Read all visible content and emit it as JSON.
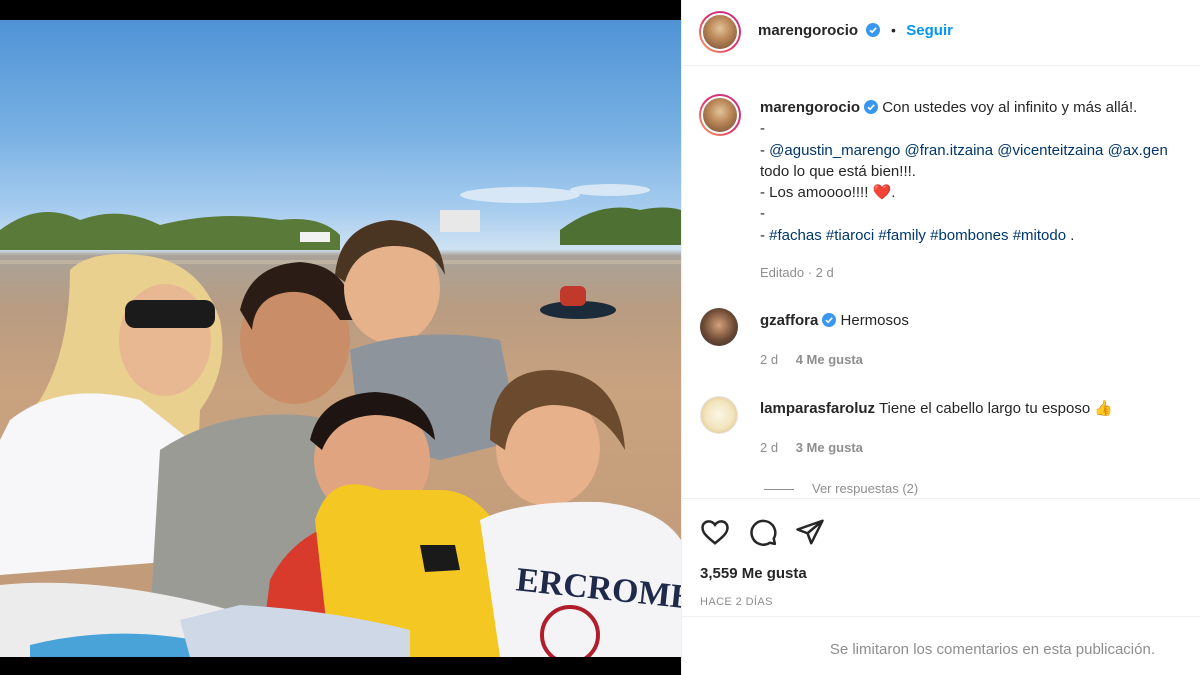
{
  "post": {
    "username": "marengorocio",
    "follow_label": "Seguir",
    "separator": "•"
  },
  "caption": {
    "username": "marengorocio",
    "line1": "Con ustedes voy al infinito y más allá!.",
    "line2": "-",
    "mentions": [
      "@agustin_marengo",
      "@fran.itzaina",
      "@vicenteitzaina",
      "@ax.gen"
    ],
    "line4": "todo lo que está bien!!!.",
    "line5": "- Los amoooo!!!! ",
    "line5_emoji": "❤️",
    "line5_end": ".",
    "line6": "-",
    "hashtags": [
      "#fachas",
      "#tiaroci",
      "#family",
      "#bombones",
      "#mitodo"
    ],
    "hashtags_end": ".",
    "edited": "Editado · 2 d"
  },
  "comments": [
    {
      "username": "gzaffora",
      "verified": true,
      "text": "Hermosos",
      "age": "2 d",
      "likes": "4 Me gusta"
    },
    {
      "username": "lamparasfaroluz",
      "verified": false,
      "text": "Tiene el cabello largo tu esposo",
      "emoji": "👍",
      "age": "2 d",
      "likes": "3 Me gusta",
      "replies": "Ver respuestas (2)"
    }
  ],
  "actions": {
    "likes": "3,559 Me gusta",
    "date": "HACE 2 DÍAS",
    "icons": [
      "heart-icon",
      "comment-icon",
      "share-icon"
    ]
  },
  "footer": {
    "notice": "Se limitaron los comentarios en esta publicación."
  },
  "colors": {
    "accent": "#0095f6",
    "verified": "#3897f0",
    "muted": "#8e8e8e",
    "text": "#262626"
  }
}
